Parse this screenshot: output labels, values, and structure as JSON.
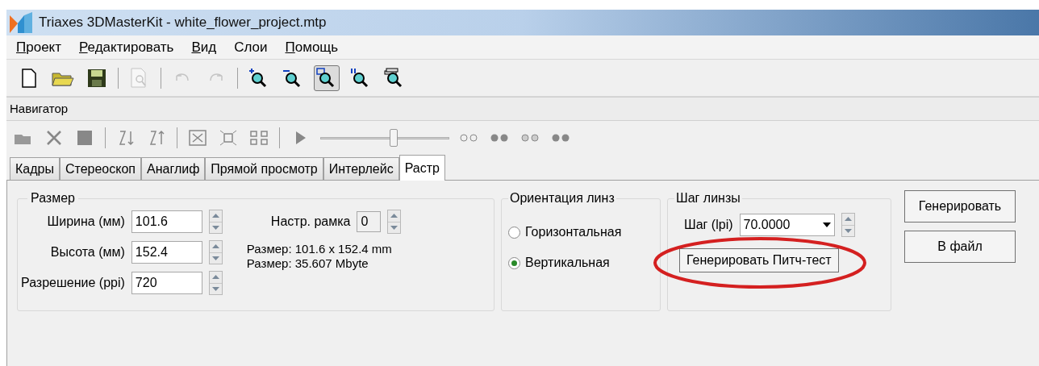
{
  "window": {
    "title": "Triaxes 3DMasterKit - white_flower_project.mtp"
  },
  "menu": [
    {
      "label": "Проект",
      "underlined_initial": true
    },
    {
      "label": "Редактировать",
      "underlined_initial": true
    },
    {
      "label": "Вид",
      "underlined_initial": true
    },
    {
      "label": "Слои",
      "underlined_initial": false
    },
    {
      "label": "Помощь",
      "underlined_initial": true
    }
  ],
  "toolbar": [
    {
      "kind": "new",
      "disabled": false,
      "selected": false
    },
    {
      "kind": "open",
      "disabled": false,
      "selected": false
    },
    {
      "kind": "save",
      "disabled": false,
      "selected": false
    },
    {
      "kind": "sep"
    },
    {
      "kind": "preview",
      "disabled": true,
      "selected": false
    },
    {
      "kind": "sep"
    },
    {
      "kind": "undo",
      "disabled": true,
      "selected": false
    },
    {
      "kind": "redo",
      "disabled": true,
      "selected": false
    },
    {
      "kind": "sep"
    },
    {
      "kind": "zoomin",
      "disabled": false,
      "selected": false
    },
    {
      "kind": "zoomout",
      "disabled": false,
      "selected": false
    },
    {
      "kind": "zoomrect",
      "disabled": false,
      "selected": true
    },
    {
      "kind": "zoom11",
      "disabled": false,
      "selected": false
    },
    {
      "kind": "zoomlayers",
      "disabled": false,
      "selected": false
    }
  ],
  "navigator": {
    "title": "Навигатор",
    "slider": {
      "level": 0.57
    }
  },
  "tabs": [
    {
      "label": "Кадры",
      "selected": false
    },
    {
      "label": "Стереоскоп",
      "selected": false
    },
    {
      "label": "Анаглиф",
      "selected": false
    },
    {
      "label": "Прямой просмотр",
      "selected": false
    },
    {
      "label": "Интерлейс",
      "selected": false
    },
    {
      "label": "Растр",
      "selected": true
    }
  ],
  "size_group": {
    "title": "Размер",
    "fields": [
      {
        "label": "Ширина (мм)",
        "value": "101.6"
      },
      {
        "label": "Высота (мм)",
        "value": "152.4"
      },
      {
        "label": "Разрешение (ppi)",
        "value": "720"
      }
    ],
    "frame": {
      "label": "Настр. рамка",
      "value": "0"
    },
    "info": [
      "Размер: 101.6 x 152.4 mm",
      "Размер: 35.607 Mbyte"
    ]
  },
  "orientation_group": {
    "title": "Ориентация линз",
    "options": [
      {
        "label": "Горизонтальная",
        "selected": false
      },
      {
        "label": "Вертикальная",
        "selected": true
      }
    ]
  },
  "pitch_group": {
    "title": "Шаг линзы",
    "label": "Шаг (lpi)",
    "value": "70.0000",
    "button": "Генерировать Питч-тест",
    "highlighted": true
  },
  "buttons": [
    "Генерировать",
    "В файл"
  ]
}
